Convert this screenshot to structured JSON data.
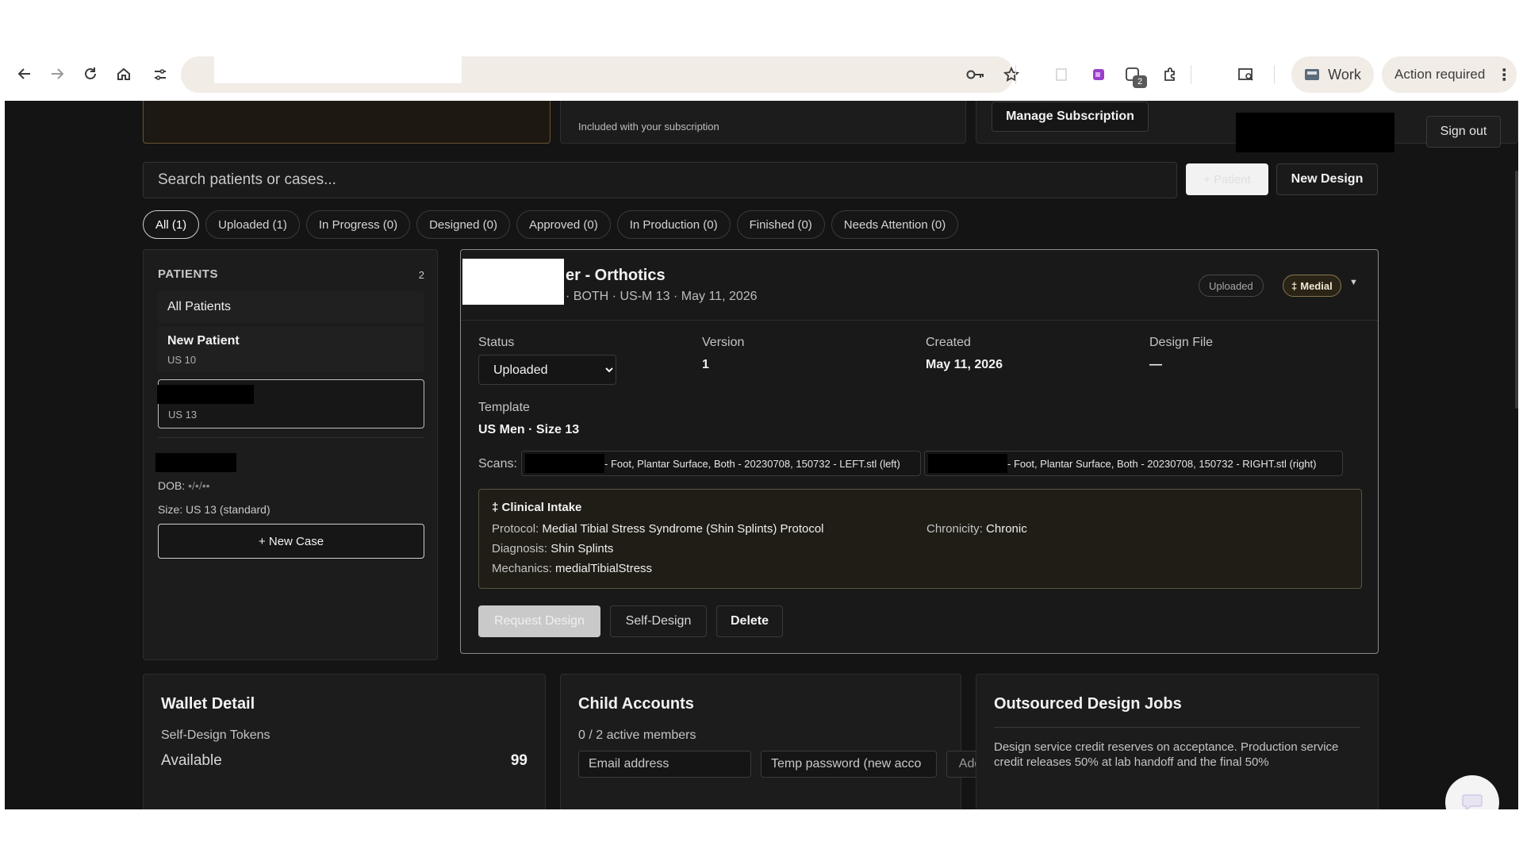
{
  "browser": {
    "work_label": "Work",
    "action_label": "Action required",
    "extension_badge": "2"
  },
  "header": {
    "included_text": "Included with your subscription",
    "manage_label": "Manage Subscription",
    "signout_label": "Sign out"
  },
  "search": {
    "placeholder": "Search patients or cases...",
    "add_patient_label": "+ Patient",
    "new_design_label": "New Design"
  },
  "filters": [
    {
      "label": "All (1)"
    },
    {
      "label": "Uploaded (1)"
    },
    {
      "label": "In Progress (0)"
    },
    {
      "label": "Designed (0)"
    },
    {
      "label": "Approved (0)"
    },
    {
      "label": "In Production (0)"
    },
    {
      "label": "Finished (0)"
    },
    {
      "label": "Needs Attention (0)"
    }
  ],
  "patients": {
    "title": "PATIENTS",
    "count": "2",
    "all_label": "All Patients",
    "new_patient_name": "New Patient",
    "new_patient_size": "US 10",
    "selected_size": "US 13",
    "dob_label": "DOB: ",
    "dob_value": "•/•/••",
    "size_text": "Size: US 13 (standard)",
    "new_case_label": "+ New Case"
  },
  "case": {
    "title": "er - Orthotics",
    "subtitle": "· BOTH · US-M 13 · May 11, 2026",
    "badge_status": "Uploaded",
    "badge_tag": "Medial",
    "status_label": "Status",
    "status_value": "Uploaded",
    "status_options": [
      "Uploaded"
    ],
    "version_label": "Version",
    "version_value": "1",
    "created_label": "Created",
    "created_value": "May 11, 2026",
    "design_file_label": "Design File",
    "design_file_value": "—",
    "template_label": "Template",
    "template_value": "US Men · Size 13",
    "scans_label": "Scans:",
    "scan_left": "- Foot, Plantar Surface, Both - 20230708, 150732 - LEFT.stl (left)",
    "scan_right": "- Foot, Plantar Surface, Both - 20230708, 150732 - RIGHT.stl (right)",
    "intake": {
      "title": "Clinical Intake",
      "protocol_label": "Protocol: ",
      "protocol_value": "Medial Tibial Stress Syndrome (Shin Splints) Protocol",
      "chronicity_label": "Chronicity: ",
      "chronicity_value": "Chronic",
      "diagnosis_label": "Diagnosis: ",
      "diagnosis_value": "Shin Splints",
      "mechanics_label": "Mechanics: ",
      "mechanics_value": "medialTibialStress"
    },
    "request_label": "Request Design",
    "selfdesign_label": "Self-Design",
    "delete_label": "Delete"
  },
  "wallet": {
    "title": "Wallet Detail",
    "subtitle": "Self-Design Tokens",
    "available_label": "Available",
    "available_value": "99"
  },
  "child": {
    "title": "Child Accounts",
    "subtitle": "0 / 2 active members",
    "email_placeholder": "Email address",
    "temp_placeholder": "Temp password (new acco",
    "add_label": "Add"
  },
  "outsourced": {
    "title": "Outsourced Design Jobs",
    "text": "Design service credit reserves on acceptance. Production service credit releases 50% at lab handoff and the final 50%"
  }
}
